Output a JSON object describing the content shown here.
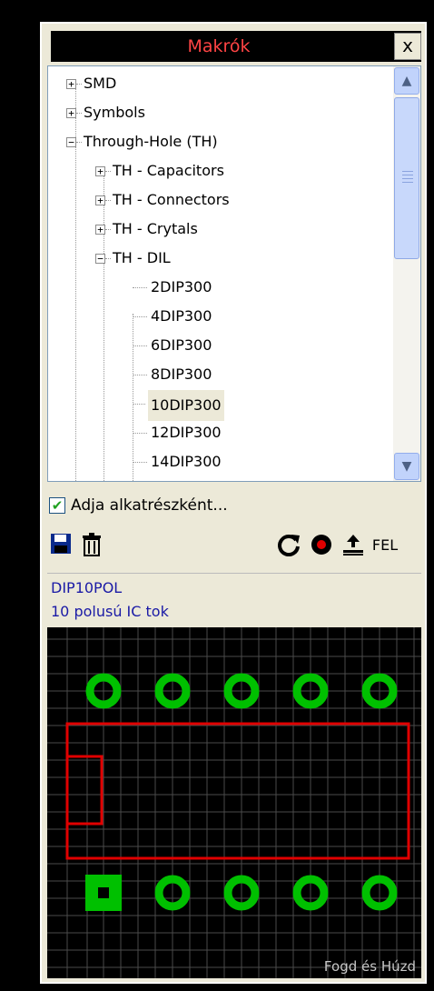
{
  "window": {
    "title": "Makrók",
    "close_label": "x"
  },
  "tree": {
    "nodes": [
      {
        "label": "SMD",
        "toggle": "+"
      },
      {
        "label": "Symbols",
        "toggle": "+"
      },
      {
        "label": "Through-Hole (TH)",
        "toggle": "−"
      },
      {
        "label": "TH - Capacitors",
        "toggle": "+"
      },
      {
        "label": "TH - Connectors",
        "toggle": "+"
      },
      {
        "label": "TH - Crytals",
        "toggle": "+"
      },
      {
        "label": "TH - DIL",
        "toggle": "−"
      },
      {
        "label": "2DIP300"
      },
      {
        "label": "4DIP300"
      },
      {
        "label": "6DIP300"
      },
      {
        "label": "8DIP300"
      },
      {
        "label": "10DIP300",
        "selected": true
      },
      {
        "label": "12DIP300"
      },
      {
        "label": "14DIP300"
      }
    ],
    "scroll_up_glyph": "▲",
    "scroll_down_glyph": "▼"
  },
  "options": {
    "add_as_component_label": "Adja alkatrészként...",
    "add_as_component_checked": true,
    "check_glyph": "✔"
  },
  "toolbar": {
    "save_icon": "floppy-disk",
    "delete_icon": "trash",
    "rotate_icon": "rotate",
    "record_icon": "record",
    "upload_icon": "upload",
    "upload_label": "FEL"
  },
  "info": {
    "name": "DIP10POL",
    "description": "10 polusú IC tok"
  },
  "preview": {
    "drag_hint": "Fogd és Húzd",
    "colors": {
      "pad": "#00c000",
      "outline": "#e00000",
      "grid": "#4a4a4a",
      "background": "#000000"
    }
  }
}
